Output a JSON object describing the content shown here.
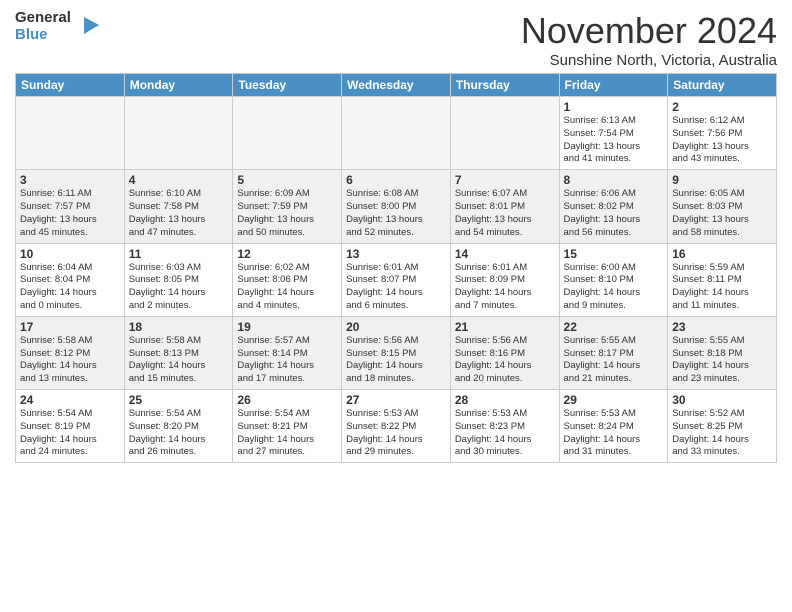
{
  "header": {
    "logo_general": "General",
    "logo_blue": "Blue",
    "month_title": "November 2024",
    "subtitle": "Sunshine North, Victoria, Australia"
  },
  "days_of_week": [
    "Sunday",
    "Monday",
    "Tuesday",
    "Wednesday",
    "Thursday",
    "Friday",
    "Saturday"
  ],
  "weeks": [
    [
      {
        "day": "",
        "info": ""
      },
      {
        "day": "",
        "info": ""
      },
      {
        "day": "",
        "info": ""
      },
      {
        "day": "",
        "info": ""
      },
      {
        "day": "",
        "info": ""
      },
      {
        "day": "1",
        "info": "Sunrise: 6:13 AM\nSunset: 7:54 PM\nDaylight: 13 hours\nand 41 minutes."
      },
      {
        "day": "2",
        "info": "Sunrise: 6:12 AM\nSunset: 7:56 PM\nDaylight: 13 hours\nand 43 minutes."
      }
    ],
    [
      {
        "day": "3",
        "info": "Sunrise: 6:11 AM\nSunset: 7:57 PM\nDaylight: 13 hours\nand 45 minutes."
      },
      {
        "day": "4",
        "info": "Sunrise: 6:10 AM\nSunset: 7:58 PM\nDaylight: 13 hours\nand 47 minutes."
      },
      {
        "day": "5",
        "info": "Sunrise: 6:09 AM\nSunset: 7:59 PM\nDaylight: 13 hours\nand 50 minutes."
      },
      {
        "day": "6",
        "info": "Sunrise: 6:08 AM\nSunset: 8:00 PM\nDaylight: 13 hours\nand 52 minutes."
      },
      {
        "day": "7",
        "info": "Sunrise: 6:07 AM\nSunset: 8:01 PM\nDaylight: 13 hours\nand 54 minutes."
      },
      {
        "day": "8",
        "info": "Sunrise: 6:06 AM\nSunset: 8:02 PM\nDaylight: 13 hours\nand 56 minutes."
      },
      {
        "day": "9",
        "info": "Sunrise: 6:05 AM\nSunset: 8:03 PM\nDaylight: 13 hours\nand 58 minutes."
      }
    ],
    [
      {
        "day": "10",
        "info": "Sunrise: 6:04 AM\nSunset: 8:04 PM\nDaylight: 14 hours\nand 0 minutes."
      },
      {
        "day": "11",
        "info": "Sunrise: 6:03 AM\nSunset: 8:05 PM\nDaylight: 14 hours\nand 2 minutes."
      },
      {
        "day": "12",
        "info": "Sunrise: 6:02 AM\nSunset: 8:06 PM\nDaylight: 14 hours\nand 4 minutes."
      },
      {
        "day": "13",
        "info": "Sunrise: 6:01 AM\nSunset: 8:07 PM\nDaylight: 14 hours\nand 6 minutes."
      },
      {
        "day": "14",
        "info": "Sunrise: 6:01 AM\nSunset: 8:09 PM\nDaylight: 14 hours\nand 7 minutes."
      },
      {
        "day": "15",
        "info": "Sunrise: 6:00 AM\nSunset: 8:10 PM\nDaylight: 14 hours\nand 9 minutes."
      },
      {
        "day": "16",
        "info": "Sunrise: 5:59 AM\nSunset: 8:11 PM\nDaylight: 14 hours\nand 11 minutes."
      }
    ],
    [
      {
        "day": "17",
        "info": "Sunrise: 5:58 AM\nSunset: 8:12 PM\nDaylight: 14 hours\nand 13 minutes."
      },
      {
        "day": "18",
        "info": "Sunrise: 5:58 AM\nSunset: 8:13 PM\nDaylight: 14 hours\nand 15 minutes."
      },
      {
        "day": "19",
        "info": "Sunrise: 5:57 AM\nSunset: 8:14 PM\nDaylight: 14 hours\nand 17 minutes."
      },
      {
        "day": "20",
        "info": "Sunrise: 5:56 AM\nSunset: 8:15 PM\nDaylight: 14 hours\nand 18 minutes."
      },
      {
        "day": "21",
        "info": "Sunrise: 5:56 AM\nSunset: 8:16 PM\nDaylight: 14 hours\nand 20 minutes."
      },
      {
        "day": "22",
        "info": "Sunrise: 5:55 AM\nSunset: 8:17 PM\nDaylight: 14 hours\nand 21 minutes."
      },
      {
        "day": "23",
        "info": "Sunrise: 5:55 AM\nSunset: 8:18 PM\nDaylight: 14 hours\nand 23 minutes."
      }
    ],
    [
      {
        "day": "24",
        "info": "Sunrise: 5:54 AM\nSunset: 8:19 PM\nDaylight: 14 hours\nand 24 minutes."
      },
      {
        "day": "25",
        "info": "Sunrise: 5:54 AM\nSunset: 8:20 PM\nDaylight: 14 hours\nand 26 minutes."
      },
      {
        "day": "26",
        "info": "Sunrise: 5:54 AM\nSunset: 8:21 PM\nDaylight: 14 hours\nand 27 minutes."
      },
      {
        "day": "27",
        "info": "Sunrise: 5:53 AM\nSunset: 8:22 PM\nDaylight: 14 hours\nand 29 minutes."
      },
      {
        "day": "28",
        "info": "Sunrise: 5:53 AM\nSunset: 8:23 PM\nDaylight: 14 hours\nand 30 minutes."
      },
      {
        "day": "29",
        "info": "Sunrise: 5:53 AM\nSunset: 8:24 PM\nDaylight: 14 hours\nand 31 minutes."
      },
      {
        "day": "30",
        "info": "Sunrise: 5:52 AM\nSunset: 8:25 PM\nDaylight: 14 hours\nand 33 minutes."
      }
    ]
  ]
}
